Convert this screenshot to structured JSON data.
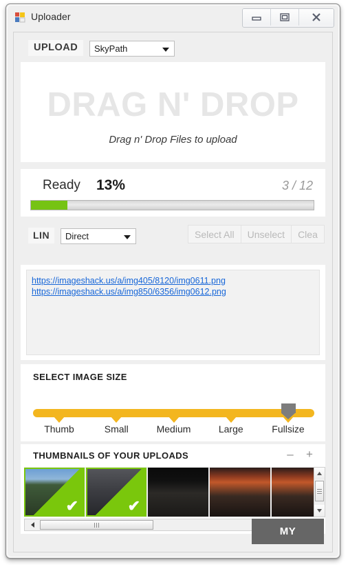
{
  "window": {
    "title": "Uploader",
    "icon": "app-window-icon",
    "controls": [
      {
        "name": "minimize-button",
        "glyph": "minimize-icon"
      },
      {
        "name": "restore-button",
        "glyph": "restore-icon"
      },
      {
        "name": "close-button",
        "glyph": "close-icon"
      }
    ]
  },
  "upload_row": {
    "label": "UPLOAD",
    "host_select": {
      "value": "SkyPath",
      "options": [
        "SkyPath"
      ]
    }
  },
  "dropzone": {
    "headline": "DRAG N' DROP",
    "subtext": "Drag n' Drop Files to upload"
  },
  "progress": {
    "status": "Ready",
    "percent_label": "13%",
    "percent_value": 13,
    "count_label": "3 / 12",
    "fill_color": "#76c313"
  },
  "link_row": {
    "label": "LIN",
    "mode_select": {
      "value": "Direct",
      "options": [
        "Direct"
      ]
    },
    "buttons": [
      {
        "name": "select-all-button",
        "label": "Select All"
      },
      {
        "name": "unselect-button",
        "label": "Unselect"
      },
      {
        "name": "clear-button",
        "label": "Clea"
      }
    ]
  },
  "links": {
    "items": [
      "https://imageshack.us/a/img405/8120/img0611.png",
      "https://imageshack.us/a/img850/6356/img0612.png"
    ],
    "link_color": "#1565d8"
  },
  "image_size": {
    "title": "SELECT IMAGE SIZE",
    "track_color": "#f3b61f",
    "handle_color": "#7d7d7d",
    "selected": "Fullsize",
    "options": [
      "Thumb",
      "Small",
      "Medium",
      "Large",
      "Fullsize"
    ]
  },
  "thumbnails": {
    "title": "THUMBNAILS OF YOUR UPLOADS",
    "zoom_out": "–",
    "zoom_in": "+",
    "selected_color": "#7ac70c",
    "check_glyph": "✔",
    "items": [
      {
        "name": "thumbnail-1",
        "selected": true
      },
      {
        "name": "thumbnail-2",
        "selected": true
      },
      {
        "name": "thumbnail-3",
        "selected": false
      },
      {
        "name": "thumbnail-4",
        "selected": false
      },
      {
        "name": "thumbnail-5",
        "selected": false
      },
      {
        "name": "thumbnail-6",
        "selected": false
      }
    ]
  },
  "footer": {
    "primary_button": "MY"
  }
}
